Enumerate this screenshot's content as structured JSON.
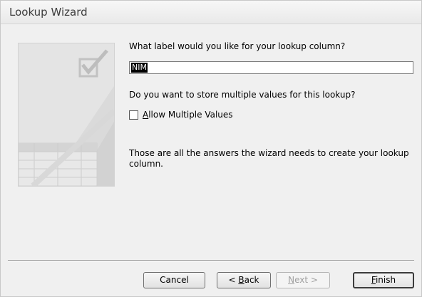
{
  "window": {
    "title": "Lookup Wizard"
  },
  "main": {
    "label_question": "What label would you like for your lookup column?",
    "label_value": "NIM",
    "multi_question": "Do you want to store multiple values for this lookup?",
    "allow_multiple": {
      "mnemonic": "A",
      "label_rest": "llow Multiple Values",
      "checked": false
    },
    "closing_note": "Those are all the answers the wizard needs to create your lookup column."
  },
  "buttons": {
    "cancel": {
      "label": "Cancel"
    },
    "back": {
      "prefix": "< ",
      "mnemonic": "B",
      "rest": "ack"
    },
    "next": {
      "mnemonic": "N",
      "rest": "ext >",
      "enabled": false
    },
    "finish": {
      "mnemonic": "F",
      "rest": "inish"
    }
  },
  "decoration": {
    "icon": "checkmark-table-icon"
  }
}
